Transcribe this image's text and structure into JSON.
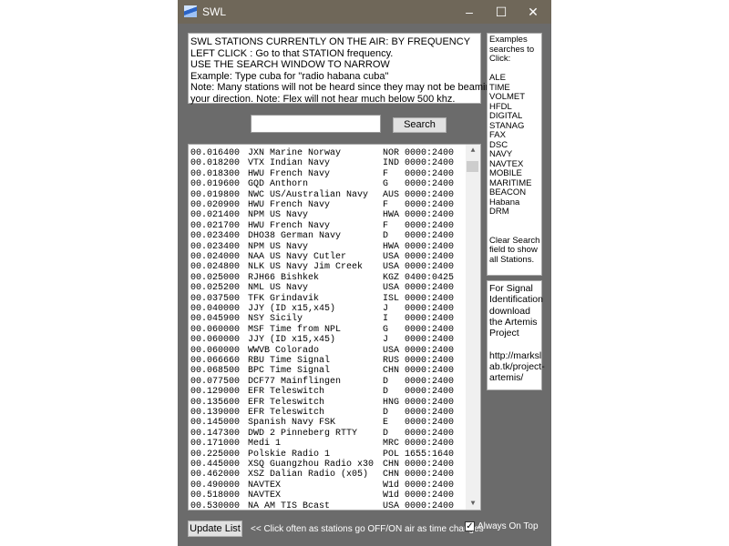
{
  "window": {
    "title": "SWL",
    "minimize_icon": "minimize-icon",
    "maximize_icon": "maximize-icon",
    "close_icon": "close-icon"
  },
  "info_lines": [
    "SWL STATIONS CURRENTLY ON THE AIR: BY FREQUENCY",
    "LEFT CLICK : Go to that STATION frequency.",
    "USE THE SEARCH WINDOW TO NARROW",
    "Example: Type cuba for \"radio habana cuba\"",
    "Note: Many stations will not be heard since they may not be beaming in",
    "your direction.  Note: Flex will not hear much below 500 khz."
  ],
  "search": {
    "value": "",
    "button_label": "Search"
  },
  "stations": [
    [
      "00.016400",
      "JXN Marine Norway",
      "NOR",
      "0000:2400"
    ],
    [
      "00.018200",
      "VTX Indian Navy",
      "IND",
      "0000:2400"
    ],
    [
      "00.018300",
      "HWU French Navy",
      "F",
      "0000:2400"
    ],
    [
      "00.019600",
      "GQD Anthorn",
      "G",
      "0000:2400"
    ],
    [
      "00.019800",
      "NWC US/Australian Navy",
      "AUS",
      "0000:2400"
    ],
    [
      "00.020900",
      "HWU French Navy",
      "F",
      "0000:2400"
    ],
    [
      "00.021400",
      "NPM US Navy",
      "HWA",
      "0000:2400"
    ],
    [
      "00.021700",
      "HWU French Navy",
      "F",
      "0000:2400"
    ],
    [
      "00.023400",
      "DHO38 German Navy",
      "D",
      "0000:2400"
    ],
    [
      "00.023400",
      "NPM US Navy",
      "HWA",
      "0000:2400"
    ],
    [
      "00.024000",
      "NAA US Navy Cutler",
      "USA",
      "0000:2400"
    ],
    [
      "00.024800",
      "NLK US Navy Jim Creek",
      "USA",
      "0000:2400"
    ],
    [
      "00.025000",
      "RJH66 Bishkek",
      "KGZ",
      "0400:0425"
    ],
    [
      "00.025200",
      "NML US Navy",
      "USA",
      "0000:2400"
    ],
    [
      "00.037500",
      "TFK Grindavik",
      "ISL",
      "0000:2400"
    ],
    [
      "00.040000",
      "JJY (ID x15,x45)",
      "J",
      "0000:2400"
    ],
    [
      "00.045900",
      "NSY Sicily",
      "I",
      "0000:2400"
    ],
    [
      "00.060000",
      "MSF Time from NPL",
      "G",
      "0000:2400"
    ],
    [
      "00.060000",
      "JJY (ID x15,x45)",
      "J",
      "0000:2400"
    ],
    [
      "00.060000",
      "WWVB Colorado",
      "USA",
      "0000:2400"
    ],
    [
      "00.066660",
      "RBU Time Signal",
      "RUS",
      "0000:2400"
    ],
    [
      "00.068500",
      "BPC Time Signal",
      "CHN",
      "0000:2400"
    ],
    [
      "00.077500",
      "DCF77 Mainflingen",
      "D",
      "0000:2400"
    ],
    [
      "00.129000",
      "EFR Teleswitch",
      "D",
      "0000:2400"
    ],
    [
      "00.135600",
      "EFR Teleswitch",
      "HNG",
      "0000:2400"
    ],
    [
      "00.139000",
      "EFR Teleswitch",
      "D",
      "0000:2400"
    ],
    [
      "00.145000",
      "Spanish Navy FSK",
      "E",
      "0000:2400"
    ],
    [
      "00.147300",
      "DWD 2 Pinneberg RTTY",
      "D",
      "0000:2400"
    ],
    [
      "00.171000",
      "Medi 1",
      "MRC",
      "0000:2400"
    ],
    [
      "00.225000",
      "Polskie Radio 1",
      "POL",
      "1655:1640"
    ],
    [
      "00.445000",
      "XSQ Guangzhou Radio x30",
      "CHN",
      "0000:2400"
    ],
    [
      "00.462000",
      "XSZ Dalian Radio (x05)",
      "CHN",
      "0000:2400"
    ],
    [
      "00.490000",
      "NAVTEX",
      "W1d",
      "0000:2400"
    ],
    [
      "00.518000",
      "NAVTEX",
      "W1d",
      "0000:2400"
    ],
    [
      "00.530000",
      "NA AM TIS Bcast",
      "USA",
      "0000:2400"
    ]
  ],
  "examples_panel": [
    "Examples",
    "searches to",
    "Click:",
    "",
    "ALE",
    "TIME",
    "VOLMET",
    "HFDL",
    "DIGITAL",
    "STANAG",
    "FAX",
    "DSC",
    "NAVY",
    "NAVTEX",
    "MOBILE",
    "MARITIME",
    "BEACON",
    "Habana",
    "DRM",
    "",
    "",
    "Clear Search",
    "field to show",
    "all Stations."
  ],
  "artemis_panel": [
    "For Signal",
    "Identification",
    "download",
    "the Artemis",
    "Project",
    "",
    "http://marksl",
    "ab.tk/project-",
    "artemis/"
  ],
  "footer": {
    "update_label": "Update List",
    "hint": "<< Click often as stations go OFF/ON air as time changes",
    "always_on_top_label": "Always On Top",
    "always_on_top_checked": true
  }
}
